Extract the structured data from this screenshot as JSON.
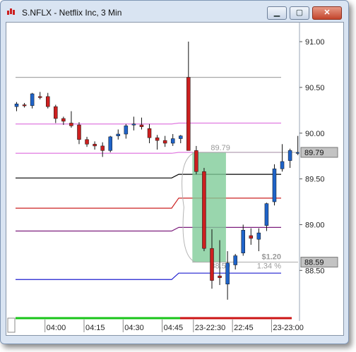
{
  "window": {
    "title": "S.NFLX - Netflix Inc, 3 Min",
    "buttons": {
      "minimize": "▁",
      "maximize": "▢",
      "close": "✕"
    }
  },
  "colors": {
    "up": "#1f63c8",
    "down": "#cc1f1f",
    "highlight": "#7fcc99",
    "session_bar_green": "#19c419",
    "session_bar_red": "#cc1414"
  },
  "chart_data": {
    "type": "candlestick",
    "ylim": [
      88.14,
      91.17
    ],
    "y_ticks": [
      91.0,
      90.5,
      90.0,
      89.5,
      89.0,
      88.5
    ],
    "y_tick_labels": [
      "91.00",
      "90.50",
      "90.00",
      "89.50",
      "89.00",
      "88.50"
    ],
    "x_tick_labels": [
      "04:00",
      "04:15",
      "04:30",
      "04:45",
      "23-22:30",
      "22:45",
      "23-23:00"
    ],
    "x_tick_bar_index": [
      3,
      8,
      13,
      18,
      22,
      27,
      32
    ],
    "price_boxes": [
      {
        "value": 89.79,
        "label": "89.79"
      },
      {
        "value": 88.59,
        "label": "88.59"
      }
    ],
    "candles": [
      {
        "open": 90.29,
        "high": 90.34,
        "low": 90.24,
        "close": 90.32
      },
      {
        "open": 90.31,
        "high": 90.33,
        "low": 90.28,
        "close": 90.3
      },
      {
        "open": 90.3,
        "high": 90.44,
        "low": 90.27,
        "close": 90.43
      },
      {
        "open": 90.4,
        "high": 90.45,
        "low": 90.37,
        "close": 90.39
      },
      {
        "open": 90.4,
        "high": 90.44,
        "low": 90.27,
        "close": 90.29
      },
      {
        "open": 90.29,
        "high": 90.31,
        "low": 90.11,
        "close": 90.16
      },
      {
        "open": 90.16,
        "high": 90.18,
        "low": 90.09,
        "close": 90.13
      },
      {
        "open": 90.11,
        "high": 90.24,
        "low": 90.06,
        "close": 90.08
      },
      {
        "open": 90.09,
        "high": 90.12,
        "low": 89.88,
        "close": 89.93
      },
      {
        "open": 89.93,
        "high": 89.96,
        "low": 89.85,
        "close": 89.88
      },
      {
        "open": 89.88,
        "high": 89.91,
        "low": 89.82,
        "close": 89.86
      },
      {
        "open": 89.86,
        "high": 89.9,
        "low": 89.74,
        "close": 89.81
      },
      {
        "open": 89.81,
        "high": 89.97,
        "low": 89.79,
        "close": 89.96
      },
      {
        "open": 89.97,
        "high": 90.04,
        "low": 89.93,
        "close": 89.99
      },
      {
        "open": 89.99,
        "high": 90.1,
        "low": 89.94,
        "close": 90.08
      },
      {
        "open": 90.09,
        "high": 90.18,
        "low": 90.03,
        "close": 90.1
      },
      {
        "open": 90.09,
        "high": 90.17,
        "low": 90.04,
        "close": 90.07
      },
      {
        "open": 90.05,
        "high": 90.1,
        "low": 89.89,
        "close": 89.95
      },
      {
        "open": 89.95,
        "high": 89.98,
        "low": 89.82,
        "close": 89.92
      },
      {
        "open": 89.92,
        "high": 89.97,
        "low": 89.85,
        "close": 89.89
      },
      {
        "open": 89.89,
        "high": 89.99,
        "low": 89.86,
        "close": 89.94
      },
      {
        "open": 89.94,
        "high": 89.98,
        "low": 89.89,
        "close": 89.97
      },
      {
        "open": 90.61,
        "high": 91.0,
        "low": 89.82,
        "close": 89.81
      },
      {
        "open": 89.81,
        "high": 89.86,
        "low": 89.55,
        "close": 89.58
      },
      {
        "open": 89.58,
        "high": 89.62,
        "low": 88.71,
        "close": 88.74
      },
      {
        "open": 88.74,
        "high": 88.95,
        "low": 88.3,
        "close": 88.39
      },
      {
        "open": 88.44,
        "high": 88.83,
        "low": 88.34,
        "close": 88.42
      },
      {
        "open": 88.35,
        "high": 88.71,
        "low": 88.18,
        "close": 88.58
      },
      {
        "open": 88.56,
        "high": 88.68,
        "low": 88.51,
        "close": 88.66
      },
      {
        "open": 88.69,
        "high": 89.0,
        "low": 88.66,
        "close": 88.94
      },
      {
        "open": 88.88,
        "high": 88.96,
        "low": 88.78,
        "close": 88.85
      },
      {
        "open": 88.84,
        "high": 88.96,
        "low": 88.71,
        "close": 88.91
      },
      {
        "open": 88.99,
        "high": 89.24,
        "low": 88.93,
        "close": 89.23
      },
      {
        "open": 89.25,
        "high": 89.66,
        "low": 89.21,
        "close": 89.61
      },
      {
        "open": 89.61,
        "high": 89.88,
        "low": 89.58,
        "close": 89.69
      },
      {
        "open": 89.7,
        "high": 89.83,
        "low": 89.62,
        "close": 89.81
      },
      {
        "open": 89.78,
        "high": 89.97,
        "low": 89.76,
        "close": 89.79
      }
    ],
    "levels": [
      {
        "name": "gray",
        "color": "#a8a8a8",
        "before": 90.61,
        "after": 90.61
      },
      {
        "name": "pink",
        "color": "#e07ae0",
        "before": 90.1,
        "after": 90.11
      },
      {
        "name": "pink2",
        "color": "#e07ae0",
        "before": 89.78,
        "after": 89.79
      },
      {
        "name": "black",
        "color": "#000000",
        "before": 89.51,
        "after": 89.55
      },
      {
        "name": "red",
        "color": "#cc2020",
        "before": 89.18,
        "after": 89.29
      },
      {
        "name": "purple",
        "color": "#7d1f7d",
        "before": 88.93,
        "after": 88.97
      },
      {
        "name": "blue",
        "color": "#1e1ecf",
        "before": 88.4,
        "after": 88.47
      }
    ],
    "measure": {
      "from_bar": 22.5,
      "to_bar": 26.8,
      "high": 89.79,
      "low": 88.59,
      "high_label": "89.79",
      "low_label": "88.59",
      "change": "$1.20",
      "change_pct": "1.34 %"
    }
  }
}
